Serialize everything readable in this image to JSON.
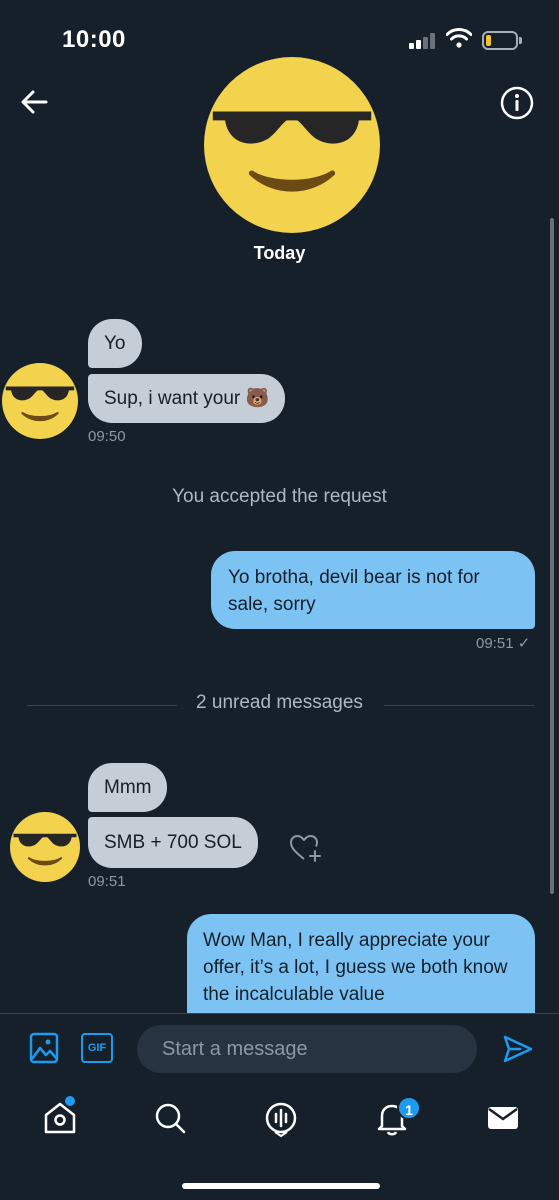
{
  "status_bar": {
    "time": "10:00"
  },
  "header": {
    "day_label": "Today"
  },
  "messages": [
    {
      "from": "them",
      "text": "Yo"
    },
    {
      "from": "them",
      "text": "Sup, i want your 🐻"
    },
    {
      "time": "09:50"
    },
    {
      "system": "You accepted the request"
    },
    {
      "from": "me",
      "text": "Yo brotha, devil bear is not for sale, sorry"
    },
    {
      "time": "09:51 ✓"
    },
    {
      "divider": "2 unread messages"
    },
    {
      "from": "them",
      "text": "Mmm"
    },
    {
      "from": "them",
      "text": "SMB + 700 SOL"
    },
    {
      "time": "09:51"
    },
    {
      "from": "me",
      "text": "Wow Man, I really appreciate your offer, it’s a lot, I guess we both know the incalculable value"
    }
  ],
  "composer": {
    "placeholder": "Start a message",
    "gif_label": "GIF"
  },
  "nav": {
    "notifications_badge": "1"
  },
  "colors": {
    "background": "#15202b",
    "accent": "#1d9bf0",
    "sent_bubble": "#7cc3f4",
    "received_bubble": "#c5cdd6"
  },
  "icons": [
    "back-arrow-icon",
    "info-icon",
    "image-icon",
    "gif-icon",
    "send-icon",
    "home-icon",
    "search-icon",
    "spaces-icon",
    "bell-icon",
    "mail-icon",
    "heart-add-icon"
  ]
}
